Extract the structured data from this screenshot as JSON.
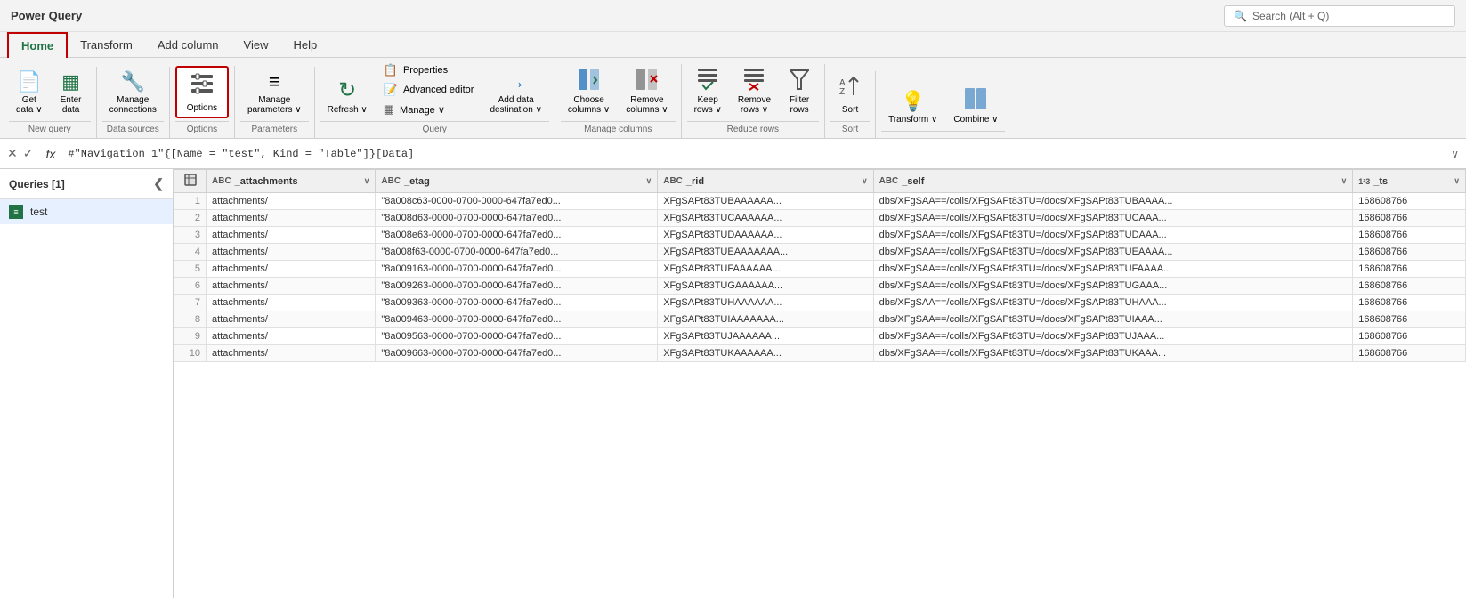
{
  "titleBar": {
    "title": "Power Query",
    "search": {
      "placeholder": "Search (Alt + Q)"
    }
  },
  "ribbon": {
    "tabs": [
      "Home",
      "Transform",
      "Add column",
      "View",
      "Help"
    ],
    "activeTab": "Home",
    "groups": [
      {
        "label": "New query",
        "items": [
          {
            "id": "get-data",
            "label": "Get\ndata",
            "icon": "📄",
            "hasDropdown": true
          },
          {
            "id": "enter-data",
            "label": "Enter\ndata",
            "icon": "⊞"
          }
        ]
      },
      {
        "label": "Data sources",
        "items": [
          {
            "id": "manage-connections",
            "label": "Manage\nconnections",
            "icon": "🔧"
          }
        ]
      },
      {
        "label": "Options",
        "items": [
          {
            "id": "options",
            "label": "Options",
            "icon": "⚙",
            "highlighted": true
          }
        ]
      },
      {
        "label": "Parameters",
        "items": [
          {
            "id": "manage-parameters",
            "label": "Manage\nparameters",
            "icon": "≡",
            "hasDropdown": true
          }
        ]
      },
      {
        "label": "Query",
        "items": [
          {
            "id": "refresh",
            "label": "Refresh",
            "icon": "↻",
            "hasDropdown": true
          },
          {
            "id": "properties-group",
            "stacked": true,
            "stackedItems": [
              {
                "id": "properties",
                "label": "Properties",
                "icon": "📋"
              },
              {
                "id": "advanced-editor",
                "label": "Advanced editor",
                "icon": "📝"
              },
              {
                "id": "manage",
                "label": "Manage",
                "icon": "⋮",
                "hasDropdown": true
              }
            ]
          },
          {
            "id": "add-data-destination",
            "label": "Add data\ndestination",
            "icon": "→",
            "hasDropdown": true
          }
        ]
      },
      {
        "label": "Manage columns",
        "items": [
          {
            "id": "choose-columns",
            "label": "Choose\ncolumns",
            "icon": "⊞",
            "hasDropdown": true
          },
          {
            "id": "remove-columns",
            "label": "Remove\ncolumns",
            "icon": "✗⊞",
            "hasDropdown": true
          }
        ]
      },
      {
        "label": "Reduce rows",
        "items": [
          {
            "id": "keep-rows",
            "label": "Keep\nrows",
            "icon": "≡↓",
            "hasDropdown": true
          },
          {
            "id": "remove-rows",
            "label": "Remove\nrows",
            "icon": "≡✗",
            "hasDropdown": true
          },
          {
            "id": "filter-rows",
            "label": "Filter\nrows",
            "icon": "▽"
          }
        ]
      },
      {
        "label": "Sort",
        "items": [
          {
            "id": "sort",
            "label": "Sort",
            "icon": "↕"
          }
        ]
      },
      {
        "label": "",
        "items": [
          {
            "id": "transform",
            "label": "Transform",
            "icon": "💡",
            "hasDropdown": true
          },
          {
            "id": "combine",
            "label": "Combine",
            "icon": "⊞⊞",
            "hasDropdown": true
          }
        ]
      }
    ]
  },
  "formulaBar": {
    "expression": "#\"Navigation 1\"{[Name = \"test\", Kind = \"Table\"]}[Data]"
  },
  "queriesPanel": {
    "title": "Queries [1]",
    "items": [
      {
        "id": "test",
        "label": "test",
        "type": "table"
      }
    ]
  },
  "grid": {
    "columns": [
      {
        "name": "_attachments",
        "type": "ABC"
      },
      {
        "name": "_etag",
        "type": "ABC"
      },
      {
        "name": "_rid",
        "type": "ABC"
      },
      {
        "name": "_self",
        "type": "ABC"
      },
      {
        "name": "_ts",
        "type": "123"
      }
    ],
    "rows": [
      {
        "num": 1,
        "_attachments": "attachments/",
        "_etag": "\"8a008c63-0000-0700-0000-647fa7ed0...",
        "_rid": "XFgSAPt83TUBAAAAAA...",
        "_self": "dbs/XFgSAA==/colls/XFgSAPt83TU=/docs/XFgSAPt83TUBAAAA...",
        "_ts": "168608766"
      },
      {
        "num": 2,
        "_attachments": "attachments/",
        "_etag": "\"8a008d63-0000-0700-0000-647fa7ed0...",
        "_rid": "XFgSAPt83TUCAAAAAA...",
        "_self": "dbs/XFgSAA==/colls/XFgSAPt83TU=/docs/XFgSAPt83TUCAAA...",
        "_ts": "168608766"
      },
      {
        "num": 3,
        "_attachments": "attachments/",
        "_etag": "\"8a008e63-0000-0700-0000-647fa7ed0...",
        "_rid": "XFgSAPt83TUDAAAAAA...",
        "_self": "dbs/XFgSAA==/colls/XFgSAPt83TU=/docs/XFgSAPt83TUDAAA...",
        "_ts": "168608766"
      },
      {
        "num": 4,
        "_attachments": "attachments/",
        "_etag": "\"8a008f63-0000-0700-0000-647fa7ed0...",
        "_rid": "XFgSAPt83TUEAAAAAAA...",
        "_self": "dbs/XFgSAA==/colls/XFgSAPt83TU=/docs/XFgSAPt83TUEAAAA...",
        "_ts": "168608766"
      },
      {
        "num": 5,
        "_attachments": "attachments/",
        "_etag": "\"8a009163-0000-0700-0000-647fa7ed0...",
        "_rid": "XFgSAPt83TUFAAAAAA...",
        "_self": "dbs/XFgSAA==/colls/XFgSAPt83TU=/docs/XFgSAPt83TUFAAAA...",
        "_ts": "168608766"
      },
      {
        "num": 6,
        "_attachments": "attachments/",
        "_etag": "\"8a009263-0000-0700-0000-647fa7ed0...",
        "_rid": "XFgSAPt83TUGAAAAAA...",
        "_self": "dbs/XFgSAA==/colls/XFgSAPt83TU=/docs/XFgSAPt83TUGAAA...",
        "_ts": "168608766"
      },
      {
        "num": 7,
        "_attachments": "attachments/",
        "_etag": "\"8a009363-0000-0700-0000-647fa7ed0...",
        "_rid": "XFgSAPt83TUHAAAAAA...",
        "_self": "dbs/XFgSAA==/colls/XFgSAPt83TU=/docs/XFgSAPt83TUHAAA...",
        "_ts": "168608766"
      },
      {
        "num": 8,
        "_attachments": "attachments/",
        "_etag": "\"8a009463-0000-0700-0000-647fa7ed0...",
        "_rid": "XFgSAPt83TUIAAAAAAA...",
        "_self": "dbs/XFgSAA==/colls/XFgSAPt83TU=/docs/XFgSAPt83TUIAAA...",
        "_ts": "168608766"
      },
      {
        "num": 9,
        "_attachments": "attachments/",
        "_etag": "\"8a009563-0000-0700-0000-647fa7ed0...",
        "_rid": "XFgSAPt83TUJAAAAAA...",
        "_self": "dbs/XFgSAA==/colls/XFgSAPt83TU=/docs/XFgSAPt83TUJAAA...",
        "_ts": "168608766"
      },
      {
        "num": 10,
        "_attachments": "attachments/",
        "_etag": "\"8a009663-0000-0700-0000-647fa7ed0...",
        "_rid": "XFgSAPt83TUKAAAAAA...",
        "_self": "dbs/XFgSAA==/colls/XFgSAPt83TU=/docs/XFgSAPt83TUKAAA...",
        "_ts": "168608766"
      }
    ]
  }
}
